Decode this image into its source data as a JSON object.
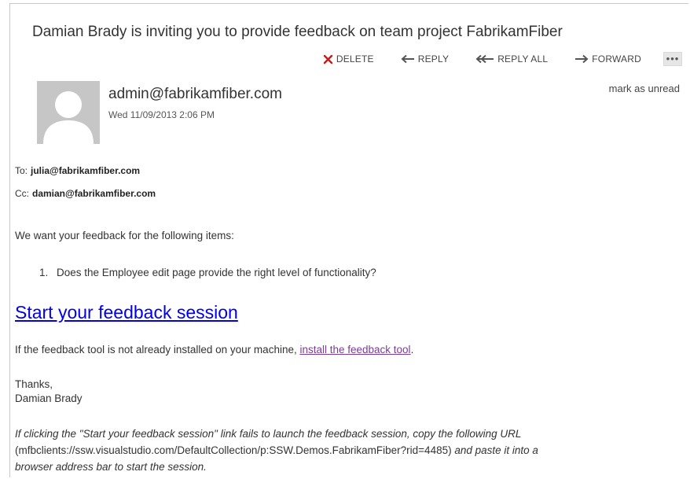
{
  "email": {
    "subject": "Damian Brady is inviting you to provide feedback on team project FabrikamFiber",
    "toolbar": {
      "delete": "DELETE",
      "reply": "REPLY",
      "reply_all": "REPLY ALL",
      "forward": "FORWARD",
      "more": "•••"
    },
    "sender": "admin@fabrikamfiber.com",
    "date": "Wed 11/09/2013 2:06 PM",
    "mark_unread": "mark as unread",
    "to_label": "To:",
    "to": "julia@fabrikamfiber.com",
    "cc_label": "Cc:",
    "cc": "damian@fabrikamfiber.com",
    "intro": "We want your feedback for the following items:",
    "items": [
      {
        "num": "1.",
        "text": "Does the Employee edit page provide the right level of functionality?"
      }
    ],
    "start_link": "Start your feedback session",
    "install_prefix": "If the feedback tool is not already installed on your machine, ",
    "install_link": "install the feedback tool",
    "install_suffix": ".",
    "thanks": "Thanks,",
    "signature": "Damian Brady",
    "note_part1": "If clicking the \"Start your feedback session\" link fails to launch the feedback session, copy the following URL",
    "note_url": "(mfbclients://ssw.visualstudio.com/DefaultCollection/p:SSW.Demos.FabrikamFiber?rid=4485)",
    "note_part2": " and paste it into a",
    "note_part3": "browser address bar to start the session."
  },
  "colors": {
    "delete_x": "#d01515",
    "link": "#0000ee",
    "visited_link": "#7b3b9a",
    "avatar_bg": "#c6c6c6"
  },
  "icons": {
    "delete": "x-icon",
    "reply": "arrow-left-icon",
    "reply_all": "double-arrow-left-icon",
    "forward": "arrow-right-icon",
    "avatar": "person-silhouette-icon"
  }
}
